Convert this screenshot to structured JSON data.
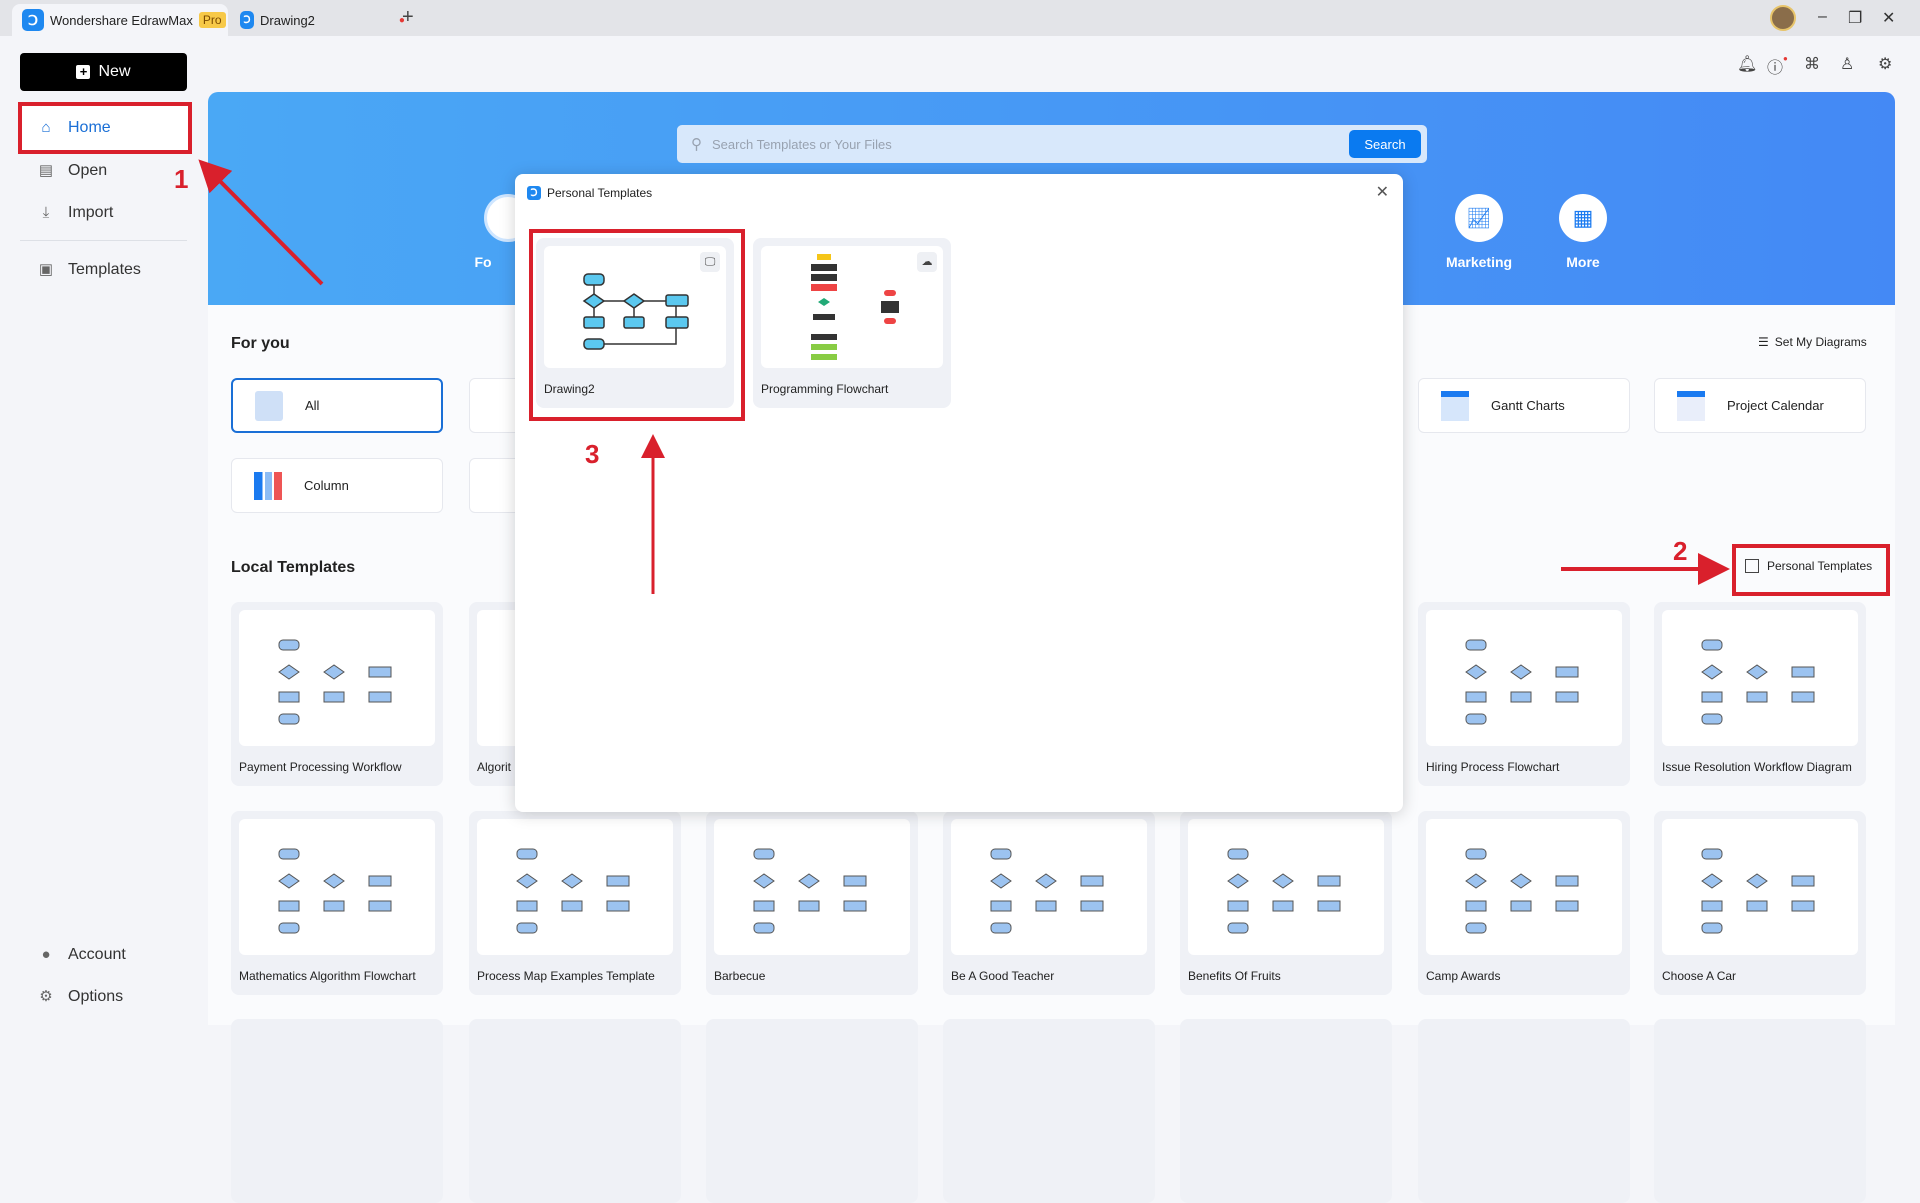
{
  "titlebar": {
    "app_tab": "Wondershare EdrawMax",
    "pro_badge": "Pro",
    "doc_tab": "Drawing2",
    "new_tab": "+",
    "minimize": "–",
    "restore": "❐",
    "close": "✕"
  },
  "sidebar": {
    "new_label": "New",
    "items": [
      {
        "label": "Home",
        "icon": "home-icon"
      },
      {
        "label": "Open",
        "icon": "file-icon"
      },
      {
        "label": "Import",
        "icon": "import-icon"
      },
      {
        "label": "Templates",
        "icon": "templates-icon"
      }
    ],
    "bottom": [
      {
        "label": "Account",
        "icon": "user-icon"
      },
      {
        "label": "Options",
        "icon": "gear-icon"
      }
    ]
  },
  "toolbar_icons": [
    "bell-icon",
    "help-icon",
    "apps-icon",
    "shirt-icon",
    "settings-icon"
  ],
  "banner": {
    "search_placeholder": "Search Templates or Your Files",
    "search_button": "Search",
    "partial_category": "Fo",
    "categories": [
      {
        "label": "Marketing",
        "icon": "chart-icon"
      },
      {
        "label": "More",
        "icon": "grid-icon"
      }
    ]
  },
  "for_you": {
    "title": "For you",
    "set_my_diagrams": "Set My Diagrams",
    "cards": [
      {
        "label": "All"
      },
      {
        "label": "Gantt Charts"
      },
      {
        "label": "Project Calendar"
      },
      {
        "label": "Column"
      }
    ]
  },
  "local_templates": {
    "title": "Local Templates",
    "personal_templates_button": "Personal Templates",
    "row1": [
      "Payment Processing Workflow",
      "Algorit",
      "",
      "",
      "",
      "Hiring Process Flowchart",
      "Issue Resolution Workflow Diagram"
    ],
    "row2": [
      "Mathematics Algorithm Flowchart",
      "Process Map Examples Template",
      "Barbecue",
      "Be A Good Teacher",
      "Benefits Of Fruits",
      "Camp Awards",
      "Choose A Car"
    ]
  },
  "modal": {
    "title": "Personal Templates",
    "close": "✕",
    "items": [
      {
        "label": "Drawing2",
        "storage": "local-computer-icon"
      },
      {
        "label": "Programming Flowchart",
        "storage": "cloud-icon"
      }
    ]
  },
  "annotations": {
    "step1": "1",
    "step2": "2",
    "step3": "3"
  },
  "colors": {
    "accent": "#0a7af0",
    "annotation": "#d9202c",
    "banner": "#4489f5"
  }
}
